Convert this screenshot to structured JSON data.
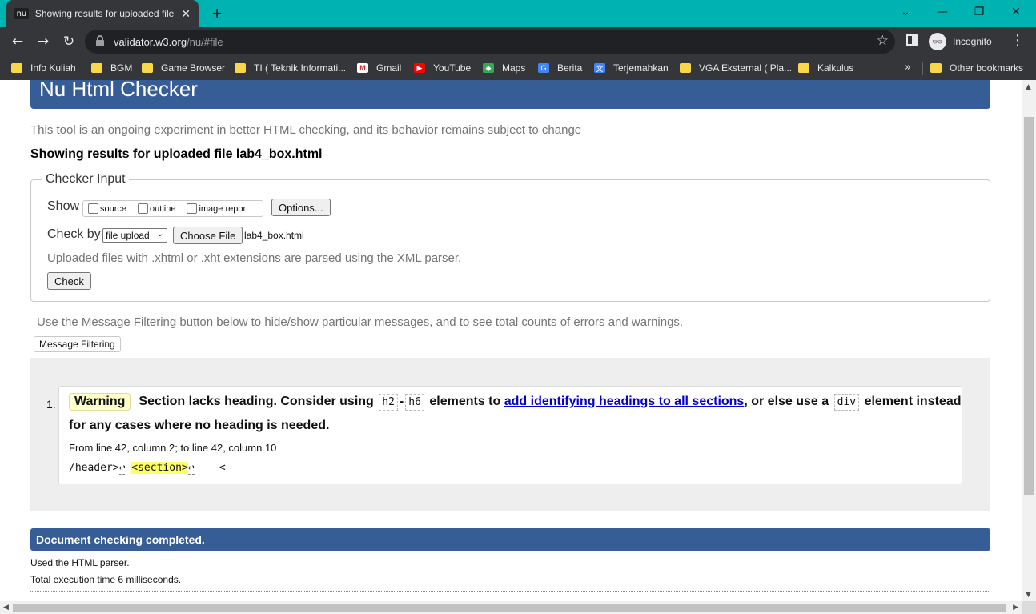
{
  "browser": {
    "tab": {
      "favicon": "nu",
      "title": "Showing results for uploaded file lab4_box.html",
      "close": "✕"
    },
    "new_tab": "+",
    "window": {
      "tabsearch": "⌄",
      "minimize": "—",
      "restore": "❐",
      "close": "✕"
    },
    "url_host": "validator.w3.org",
    "url_path": "/nu/#file",
    "star": "☆",
    "profile_icon": "👓",
    "profile_label": "Incognito",
    "menu": "⋮",
    "bookmarks": [
      {
        "label": "Info Kuliah",
        "icon": "folder"
      },
      {
        "label": "BGM",
        "icon": "folder"
      },
      {
        "label": "Game Browser",
        "icon": "folder"
      },
      {
        "label": "TI ( Teknik Informati...",
        "icon": "folder"
      },
      {
        "label": "Gmail",
        "icon": "gmail-icon"
      },
      {
        "label": "YouTube",
        "icon": "youtube-icon"
      },
      {
        "label": "Maps",
        "icon": "maps-icon"
      },
      {
        "label": "Berita",
        "icon": "news-icon"
      },
      {
        "label": "Terjemahkan",
        "icon": "translate-icon"
      },
      {
        "label": "VGA Eksternal ( Pla...",
        "icon": "folder"
      },
      {
        "label": "Kalkulus",
        "icon": "folder"
      }
    ],
    "bookmarks_more": "»",
    "other_bookmarks": "Other bookmarks",
    "colors": {
      "titlebar": "#00b3b3",
      "chrome": "#35363a",
      "omnibox": "#202124"
    }
  },
  "page": {
    "title": "Nu Html Checker",
    "intro": "This tool is an ongoing experiment in better HTML checking, and its behavior remains subject to change",
    "results_heading": "Showing results for uploaded file lab4_box.html",
    "checker": {
      "legend": "Checker Input",
      "show_label": "Show",
      "options": [
        "source",
        "outline",
        "image report"
      ],
      "options_button": "Options...",
      "checkby_label": "Check by",
      "checkby_value": "file upload",
      "choose_file": "Choose File",
      "filename": "lab4_box.html",
      "parser_note": "Uploaded files with .xhtml or .xht extensions are parsed using the XML parser.",
      "check_button": "Check"
    },
    "filter_text": "Use the Message Filtering button below to hide/show particular messages, and to see total counts of errors and warnings.",
    "filter_button": "Message Filtering",
    "message": {
      "number": "1.",
      "type": "Warning",
      "text1": "Section lacks heading. Consider using",
      "code1": "h2",
      "dash": "-",
      "code2": "h6",
      "text2": "elements to",
      "link": "add identifying headings to all sections",
      "text3": ", or else use a",
      "code3": "div",
      "text4": "element instead",
      "text5": "for any cases where no heading is needed.",
      "location": "From line 42, column 2; to line 42, column 10",
      "extract_pre": "/header>",
      "extract_lf1": "↩",
      "extract_highlight": "<section>",
      "extract_lf2": "↩",
      "extract_post": "<"
    },
    "done": "Document checking completed.",
    "parser_used": "Used the HTML parser.",
    "exec_time": "Total execution time 6 milliseconds.",
    "colors": {
      "header": "#365d95",
      "warning": "#ffffcc",
      "highlight": "#ffff66"
    }
  }
}
